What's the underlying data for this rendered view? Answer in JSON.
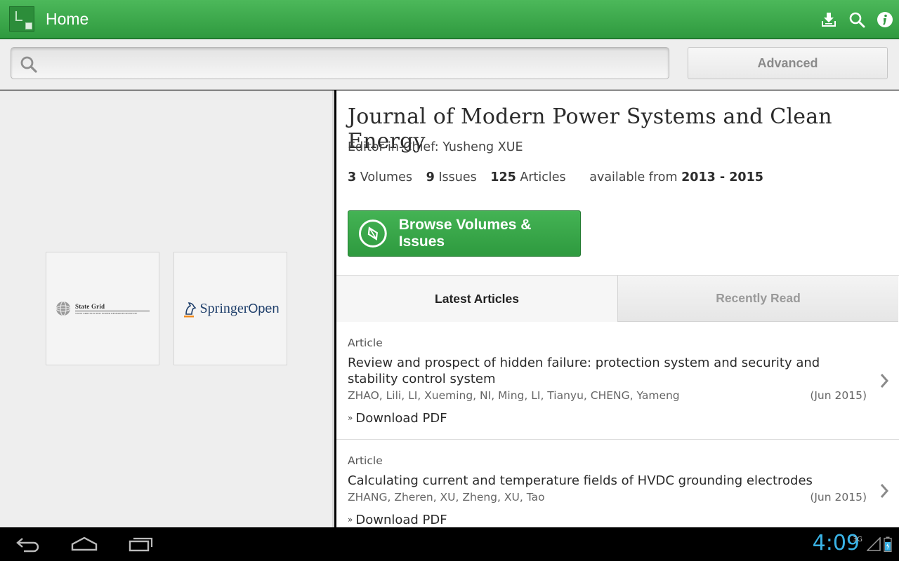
{
  "actionbar": {
    "title": "Home",
    "actions": [
      {
        "icon": "download-icon"
      },
      {
        "icon": "search-icon"
      },
      {
        "icon": "info-icon"
      }
    ],
    "color": "#3aa74a"
  },
  "search": {
    "placeholder": "",
    "value": "",
    "advanced_label": "Advanced"
  },
  "journal": {
    "title": "Journal of Modern Power Systems and Clean Energy",
    "editor": "Editor-in-Chief: Yusheng XUE",
    "stats": {
      "volumes_count": "3",
      "volumes_label": "Volumes",
      "issues_count": "9",
      "issues_label": "Issues",
      "articles_count": "125",
      "articles_label": "Articles",
      "available_label": "available from",
      "available_range": "2013 - 2015"
    },
    "browse_label": "Browse Volumes & Issues"
  },
  "logos": {
    "state_grid": {
      "name": "State Grid",
      "subtitle": "STATE GRID ELECTRIC POWER RESEARCH INSTITUTE"
    },
    "springer": {
      "name": "Springer",
      "suffix": "Open"
    }
  },
  "tabs": [
    {
      "label": "Latest Articles",
      "active": true
    },
    {
      "label": "Recently Read",
      "active": false
    }
  ],
  "articles": [
    {
      "type": "Article",
      "title": "Review and prospect of hidden failure: protection system and security and stability control system",
      "authors": "ZHAO, Lili, LI, Xueming, NI, Ming, LI, Tianyu, CHENG, Yameng",
      "date": "(Jun 2015)",
      "download_label": "Download PDF"
    },
    {
      "type": "Article",
      "title": "Calculating current and temperature fields of HVDC grounding electrodes",
      "authors": "ZHANG, Zheren, XU, Zheng, XU, Tao",
      "date": "(Jun 2015)",
      "download_label": "Download PDF"
    }
  ],
  "statusbar": {
    "time": "4:09",
    "network": "3G"
  }
}
